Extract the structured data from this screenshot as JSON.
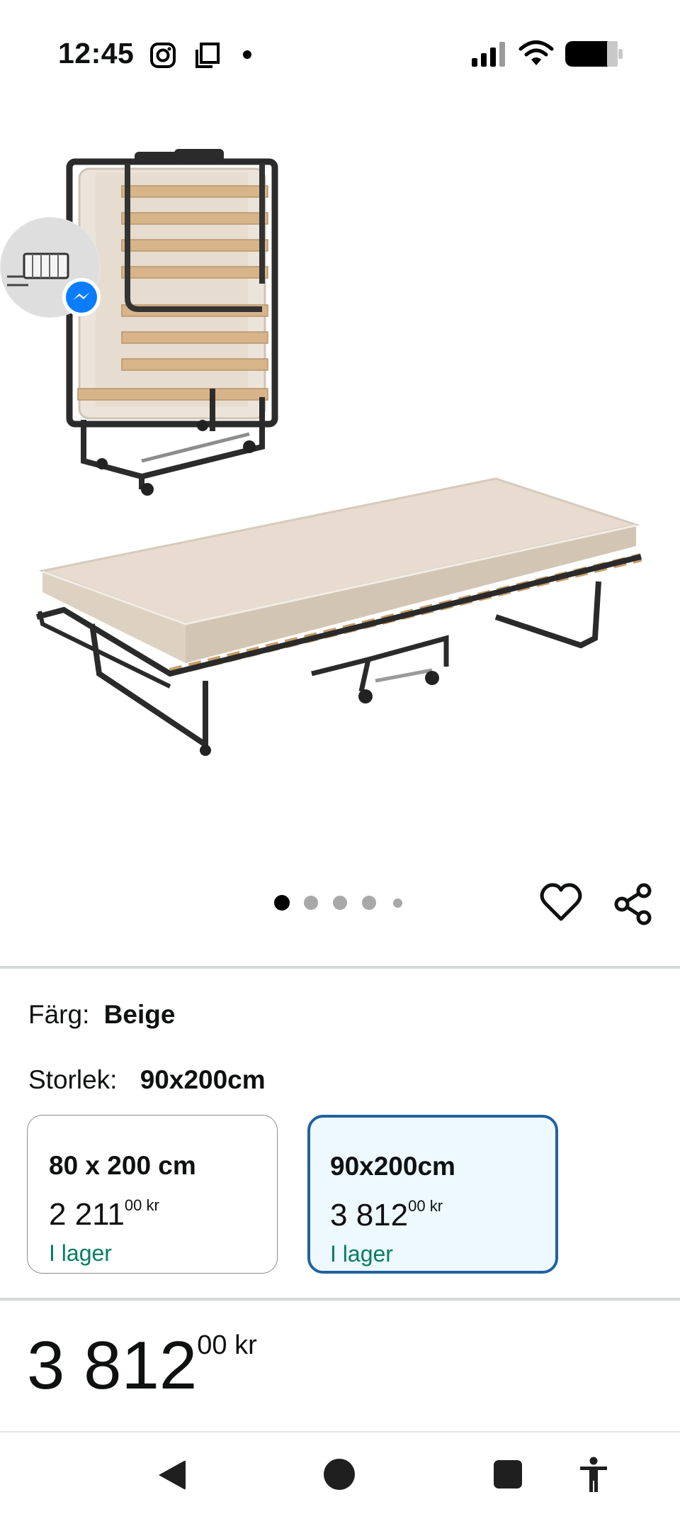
{
  "status_bar": {
    "time": "12:45"
  },
  "carousel": {
    "total": 5,
    "active": 1
  },
  "product": {
    "color_label": "Färg:",
    "color_value": "Beige",
    "size_label": "Storlek:",
    "size_value": "90x200cm",
    "size_options": [
      {
        "title": "80 x 200 cm",
        "price_whole": "2 211",
        "price_frac": "00",
        "currency": "kr",
        "stock": "I lager",
        "selected": false
      },
      {
        "title": "90x200cm",
        "price_whole": "3 812",
        "price_frac": "00",
        "currency": "kr",
        "stock": "I lager",
        "selected": true
      }
    ],
    "price_whole": "3 812",
    "price_frac": "00",
    "currency": "kr"
  },
  "colors": {
    "accent_selected_border": "#2162a1",
    "selected_bg": "#edf8ff",
    "in_stock": "#067d62",
    "messenger": "#0a7cff"
  },
  "icons": [
    "instagram-icon",
    "copy-icon",
    "signal-icon",
    "wifi-icon",
    "battery-icon",
    "messenger-icon",
    "heart-icon",
    "share-icon",
    "back-icon",
    "home-icon",
    "recents-icon",
    "accessibility-icon"
  ]
}
